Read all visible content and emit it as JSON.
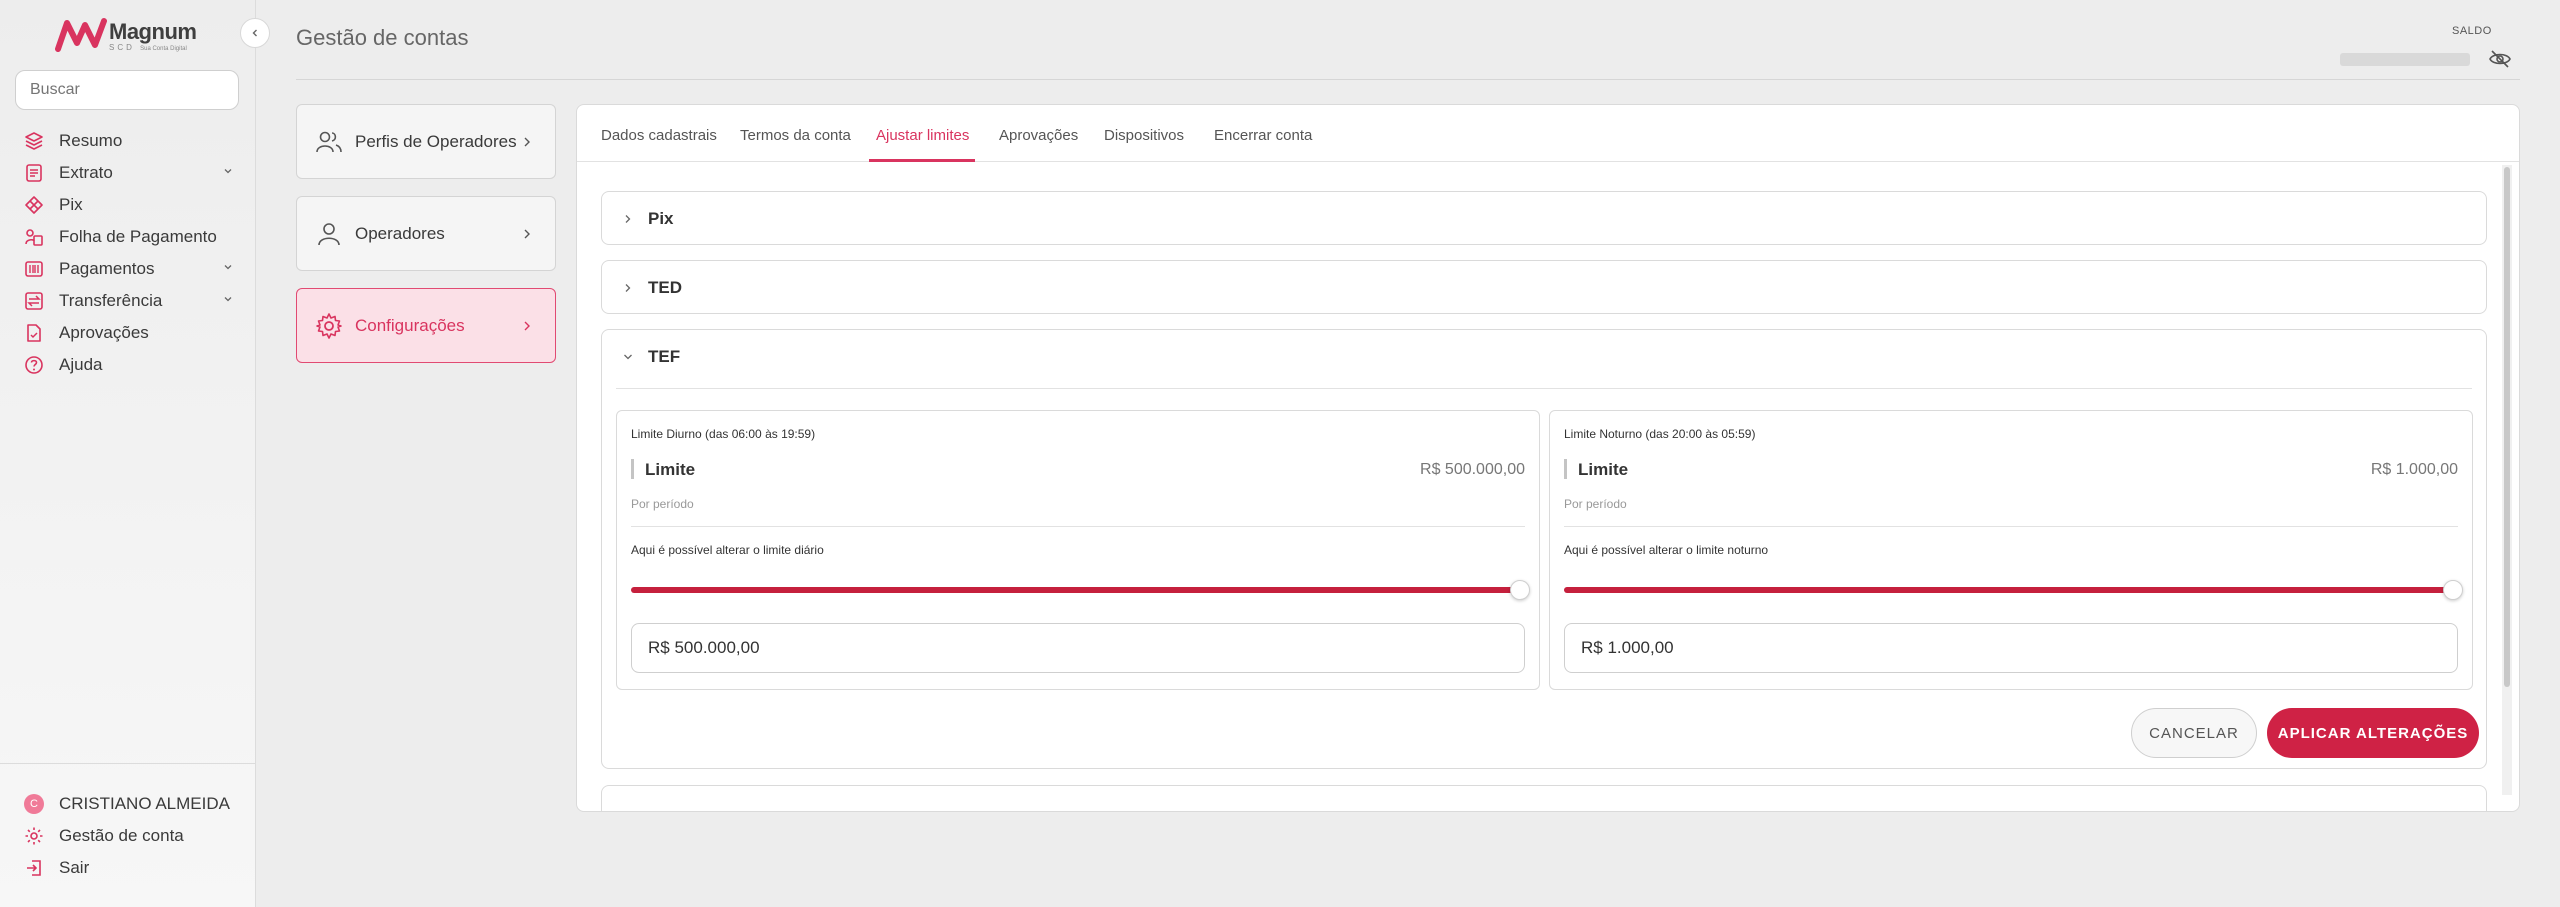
{
  "brand": {
    "name": "Magnum",
    "sub": "SCD",
    "tagline": "Sua Conta Digital",
    "accent": "#d9345f"
  },
  "sidebar": {
    "search_placeholder": "Buscar",
    "items": [
      {
        "label": "Resumo",
        "icon": "layers-icon",
        "has_submenu": false
      },
      {
        "label": "Extrato",
        "icon": "document-icon",
        "has_submenu": true
      },
      {
        "label": "Pix",
        "icon": "pix-icon",
        "has_submenu": false
      },
      {
        "label": "Folha de Pagamento",
        "icon": "payroll-icon",
        "has_submenu": false
      },
      {
        "label": "Pagamentos",
        "icon": "barcode-icon",
        "has_submenu": true
      },
      {
        "label": "Transferência",
        "icon": "transfer-icon",
        "has_submenu": true
      },
      {
        "label": "Aprovações",
        "icon": "approval-icon",
        "has_submenu": false
      },
      {
        "label": "Ajuda",
        "icon": "help-icon",
        "has_submenu": false
      }
    ],
    "footer": {
      "user_initial": "C",
      "user_name": "CRISTIANO ALMEIDA",
      "account_management": "Gestão de conta",
      "logout": "Sair"
    }
  },
  "header": {
    "title": "Gestão de contas",
    "balance_label": "SALDO"
  },
  "settings_menu": {
    "items": [
      {
        "label": "Perfis de Operadores",
        "icon": "users-icon",
        "active": false
      },
      {
        "label": "Operadores",
        "icon": "user-icon",
        "active": false
      },
      {
        "label": "Configurações",
        "icon": "gear-icon",
        "active": true
      }
    ]
  },
  "tabs": [
    {
      "label": "Dados cadastrais",
      "active": false
    },
    {
      "label": "Termos da conta",
      "active": false
    },
    {
      "label": "Ajustar limites",
      "active": true
    },
    {
      "label": "Aprovações",
      "active": false
    },
    {
      "label": "Dispositivos",
      "active": false
    },
    {
      "label": "Encerrar conta",
      "active": false
    }
  ],
  "accordions": [
    {
      "title": "Pix",
      "expanded": false
    },
    {
      "title": "TED",
      "expanded": false
    },
    {
      "title": "TEF",
      "expanded": true
    }
  ],
  "tef": {
    "day": {
      "title": "Limite Diurno (das 06:00 às 19:59)",
      "label": "Limite",
      "value": "R$ 500.000,00",
      "period": "Por período",
      "hint": "Aqui é possível alterar o limite diário",
      "slider_level": 1.0,
      "input_value": "R$ 500.000,00"
    },
    "night": {
      "title": "Limite Noturno (das 20:00 às 05:59)",
      "label": "Limite",
      "value": "R$ 1.000,00",
      "period": "Por período",
      "hint": "Aqui é possível alterar o limite noturno",
      "slider_level": 1.0,
      "input_value": "R$ 1.000,00"
    },
    "cancel_label": "CANCELAR",
    "apply_label": "APLICAR ALTERAÇÕES"
  }
}
